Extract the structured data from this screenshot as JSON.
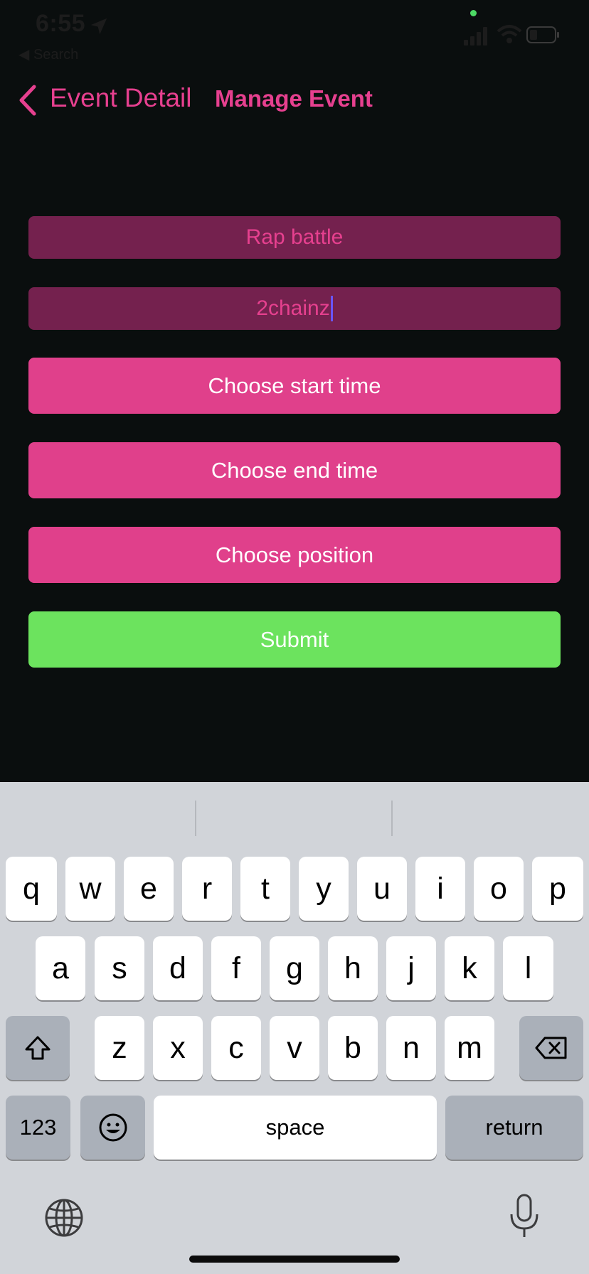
{
  "status_bar": {
    "time": "6:55",
    "back_app": "◀ Search"
  },
  "nav": {
    "back_label": "Event Detail",
    "title": "Manage Event"
  },
  "form": {
    "name_value": "Rap battle",
    "artist_value": "2chainz",
    "start_button": "Choose start time",
    "end_button": "Choose end time",
    "position_button": "Choose position",
    "submit_button": "Submit"
  },
  "keyboard": {
    "row1": [
      "q",
      "w",
      "e",
      "r",
      "t",
      "y",
      "u",
      "i",
      "o",
      "p"
    ],
    "row2": [
      "a",
      "s",
      "d",
      "f",
      "g",
      "h",
      "j",
      "k",
      "l"
    ],
    "row3": [
      "z",
      "x",
      "c",
      "v",
      "b",
      "n",
      "m"
    ],
    "numbers_label": "123",
    "space_label": "space",
    "return_label": "return"
  },
  "colors": {
    "accent": "#e6408f",
    "field_bg": "#74214e",
    "submit": "#6ce35e",
    "background": "#0a0e0e"
  },
  "icons": [
    "location-arrow-icon",
    "signal-icon",
    "wifi-icon",
    "battery-icon",
    "chevron-left-icon",
    "shift-icon",
    "backspace-icon",
    "emoji-icon",
    "globe-icon",
    "microphone-icon"
  ]
}
